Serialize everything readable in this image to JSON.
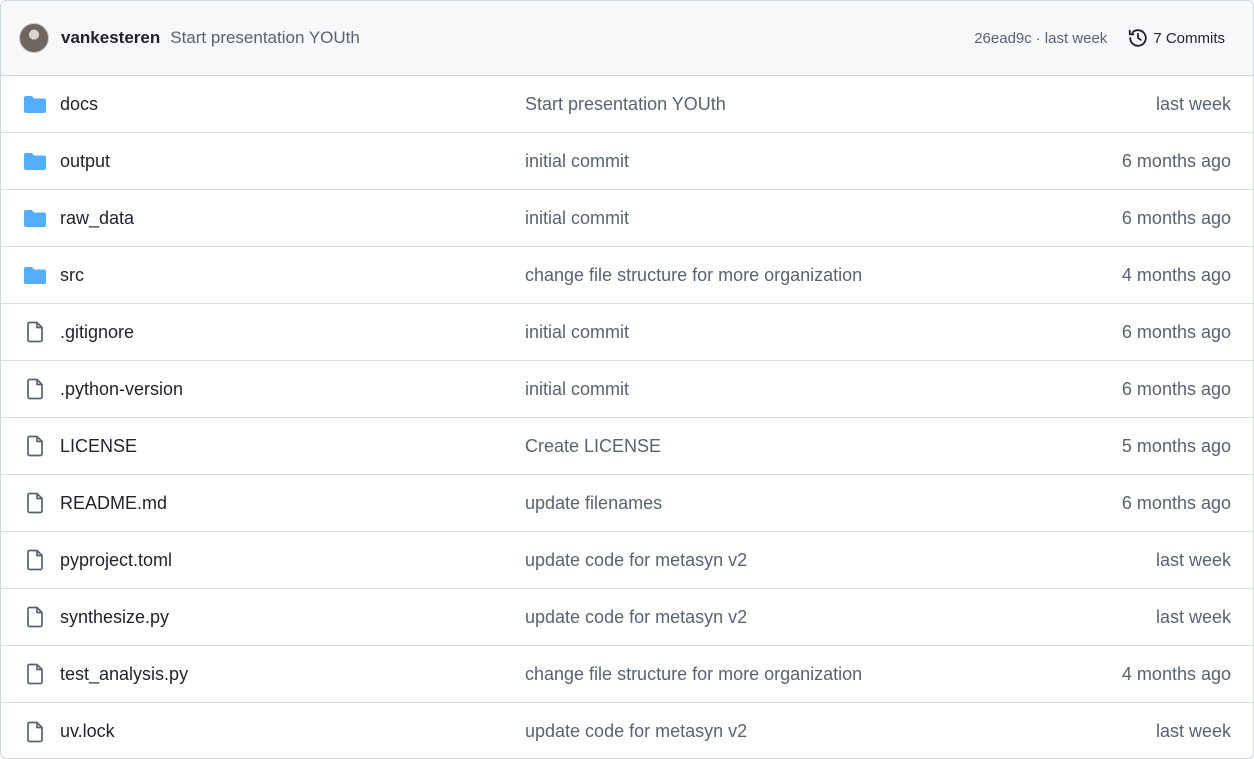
{
  "header": {
    "author": "vankesteren",
    "message": "Start presentation YOUth",
    "hash": "26ead9c",
    "separator": "·",
    "age": "last week",
    "commits_label": "7 Commits",
    "history_icon": "history-icon"
  },
  "colors": {
    "folder": "#54aeff",
    "file_icon": "#59636e",
    "muted_text": "#59636e"
  },
  "rows": [
    {
      "type": "folder",
      "name": "docs",
      "message": "Start presentation YOUth",
      "time": "last week"
    },
    {
      "type": "folder",
      "name": "output",
      "message": "initial commit",
      "time": "6 months ago"
    },
    {
      "type": "folder",
      "name": "raw_data",
      "message": "initial commit",
      "time": "6 months ago"
    },
    {
      "type": "folder",
      "name": "src",
      "message": "change file structure for more organization",
      "time": "4 months ago"
    },
    {
      "type": "file",
      "name": ".gitignore",
      "message": "initial commit",
      "time": "6 months ago"
    },
    {
      "type": "file",
      "name": ".python-version",
      "message": "initial commit",
      "time": "6 months ago"
    },
    {
      "type": "file",
      "name": "LICENSE",
      "message": "Create LICENSE",
      "time": "5 months ago"
    },
    {
      "type": "file",
      "name": "README.md",
      "message": "update filenames",
      "time": "6 months ago"
    },
    {
      "type": "file",
      "name": "pyproject.toml",
      "message": "update code for metasyn v2",
      "time": "last week"
    },
    {
      "type": "file",
      "name": "synthesize.py",
      "message": "update code for metasyn v2",
      "time": "last week"
    },
    {
      "type": "file",
      "name": "test_analysis.py",
      "message": "change file structure for more organization",
      "time": "4 months ago"
    },
    {
      "type": "file",
      "name": "uv.lock",
      "message": "update code for metasyn v2",
      "time": "last week"
    }
  ]
}
